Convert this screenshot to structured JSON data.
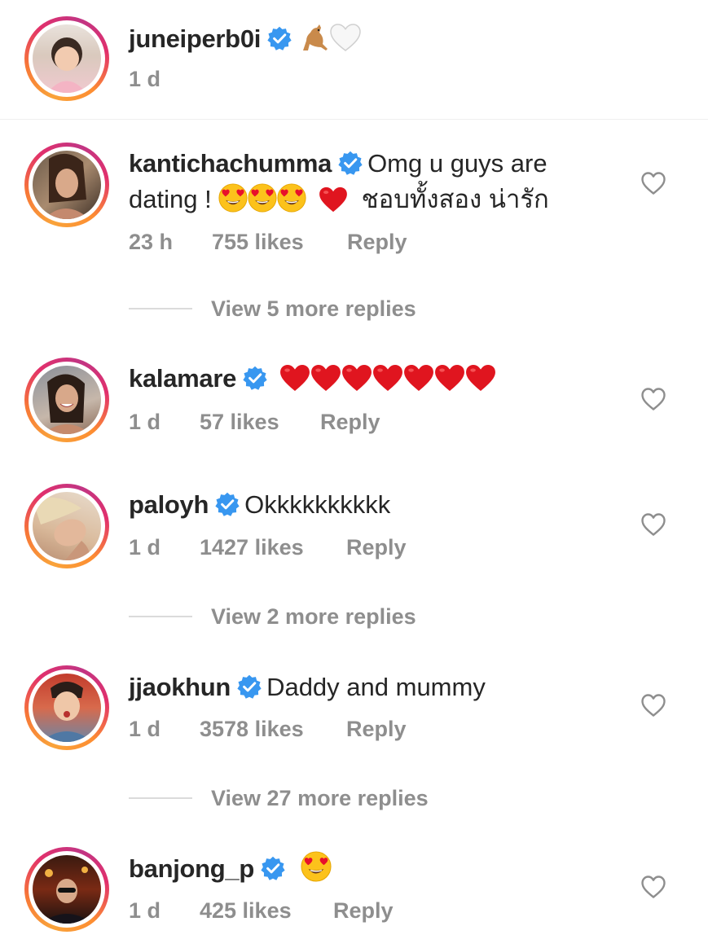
{
  "caption": {
    "username": "juneiperb0i",
    "time": "1 d"
  },
  "comments": [
    {
      "username": "kantichachumma",
      "text_line1": "Omg u guys are",
      "text_line2": "dating !",
      "text_line2_tail": "ชอบทั้งสอง น่ารัก",
      "time": "23 h",
      "likes": "755 likes",
      "reply": "Reply",
      "view_replies": "View 5 more replies"
    },
    {
      "username": "kalamare",
      "time": "1 d",
      "likes": "57 likes",
      "reply": "Reply"
    },
    {
      "username": "paloyh",
      "text": "Okkkkkkkkkk",
      "time": "1 d",
      "likes": "1427 likes",
      "reply": "Reply",
      "view_replies": "View 2 more replies"
    },
    {
      "username": "jjaokhun",
      "text": "Daddy and mummy",
      "time": "1 d",
      "likes": "3578 likes",
      "reply": "Reply",
      "view_replies": "View 27 more replies"
    },
    {
      "username": "banjong_p",
      "time": "1 d",
      "likes": "425 likes",
      "reply": "Reply"
    }
  ],
  "colors": {
    "verified_blue": "#3897f0",
    "heart_red": "#ed1c24",
    "meta_gray": "#8e8e8e"
  },
  "icons": [
    "verified-badge-icon",
    "kangaroo-emoji-icon",
    "white-heart-emoji-icon",
    "heart-eyes-emoji-icon",
    "red-heart-emoji-icon",
    "like-heart-outline-icon"
  ]
}
